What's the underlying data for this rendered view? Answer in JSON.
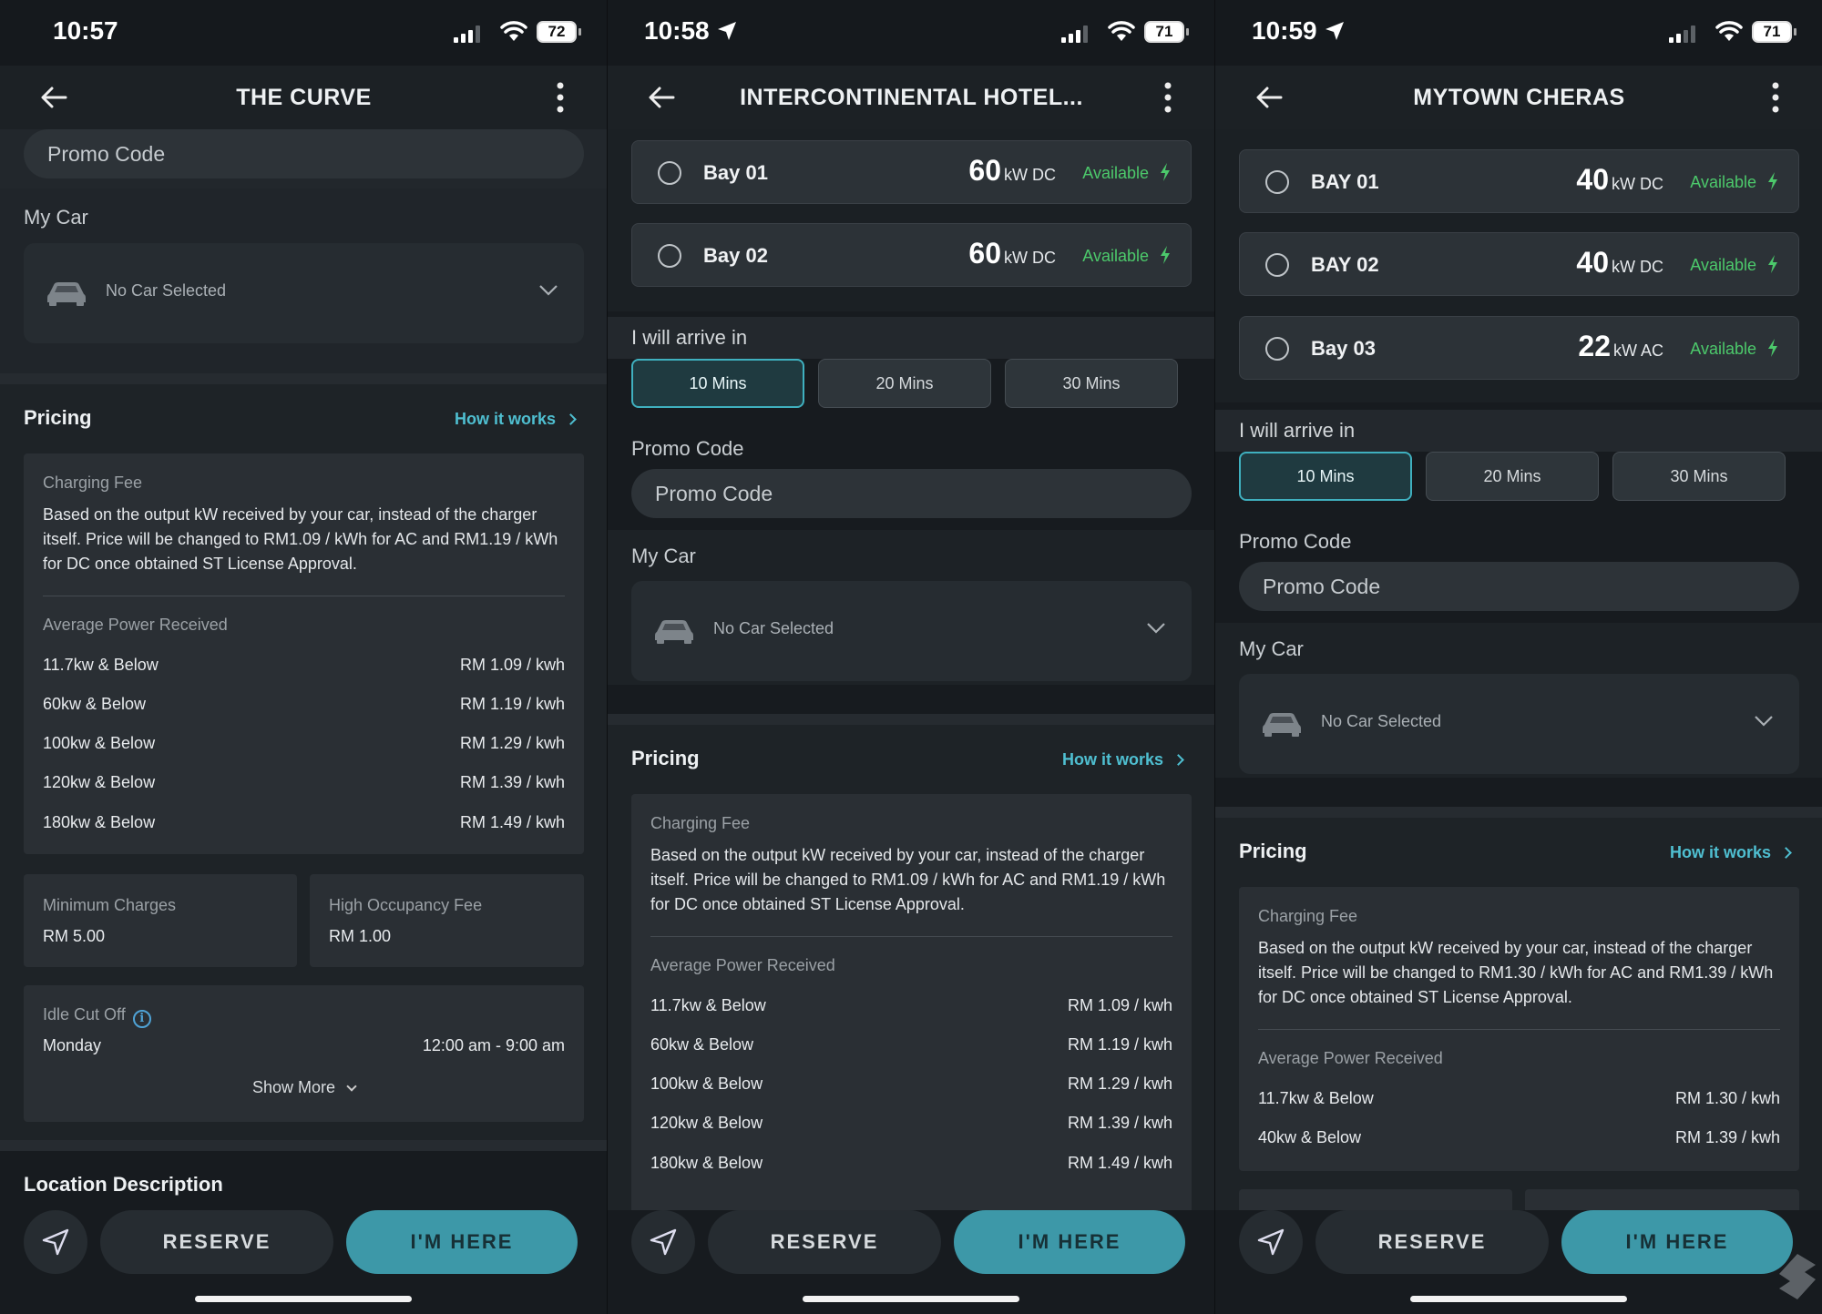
{
  "screens": [
    {
      "status": {
        "time": "10:57",
        "battery": "72",
        "location_arrow": false
      },
      "title": "THE CURVE",
      "promo_placeholder": "Promo Code",
      "my_car_label": "My Car",
      "car_value": "No Car Selected",
      "pricing": {
        "heading": "Pricing",
        "how_label": "How it works",
        "fee_title": "Charging Fee",
        "fee_desc": "Based on the output kW received by your car, instead of the charger itself. Price will be changed to RM1.09 / kWh for AC and RM1.19 / kWh for DC once obtained ST License Approval.",
        "avg_title": "Average Power Received",
        "rows": [
          {
            "tier": "11.7kw & Below",
            "price": "RM 1.09 / kwh"
          },
          {
            "tier": "60kw & Below",
            "price": "RM 1.19 / kwh"
          },
          {
            "tier": "100kw & Below",
            "price": "RM 1.29 / kwh"
          },
          {
            "tier": "120kw & Below",
            "price": "RM 1.39 / kwh"
          },
          {
            "tier": "180kw & Below",
            "price": "RM 1.49 / kwh"
          }
        ]
      },
      "min_charges_label": "Minimum Charges",
      "min_charges_value": "RM 5.00",
      "high_occ_label": "High Occupancy Fee",
      "high_occ_value": "RM 1.00",
      "idle_label": "Idle Cut Off",
      "idle_day": "Monday",
      "idle_time": "12:00 am - 9:00 am",
      "show_more": "Show More",
      "location_desc": "Location Description",
      "reserve": "RESERVE",
      "im_here": "I'M HERE"
    },
    {
      "status": {
        "time": "10:58",
        "battery": "71",
        "location_arrow": true
      },
      "title": "INTERCONTINENTAL HOTEL...",
      "bays": [
        {
          "name": "Bay 01",
          "kw": "60",
          "type": "kW DC",
          "status": "Available"
        },
        {
          "name": "Bay 02",
          "kw": "60",
          "type": "kW DC",
          "status": "Available"
        }
      ],
      "arrive_label": "I will arrive in",
      "mins": [
        "10 Mins",
        "20 Mins",
        "30 Mins"
      ],
      "selected_min": "10 Mins",
      "promo_label": "Promo Code",
      "promo_placeholder": "Promo Code",
      "my_car_label": "My Car",
      "car_value": "No Car Selected",
      "pricing": {
        "heading": "Pricing",
        "how_label": "How it works",
        "fee_title": "Charging Fee",
        "fee_desc": "Based on the output kW received by your car, instead of the charger itself. Price will be changed to RM1.09 / kWh for AC and RM1.19 / kWh for DC once obtained ST License Approval.",
        "avg_title": "Average Power Received",
        "rows": [
          {
            "tier": "11.7kw & Below",
            "price": "RM 1.09 / kwh"
          },
          {
            "tier": "60kw & Below",
            "price": "RM 1.19 / kwh"
          },
          {
            "tier": "100kw & Below",
            "price": "RM 1.29 / kwh"
          },
          {
            "tier": "120kw & Below",
            "price": "RM 1.39 / kwh"
          },
          {
            "tier": "180kw & Below",
            "price": "RM 1.49 / kwh"
          }
        ]
      },
      "reserve": "RESERVE",
      "im_here": "I'M HERE"
    },
    {
      "status": {
        "time": "10:59",
        "battery": "71",
        "location_arrow": true
      },
      "title": "MYTOWN CHERAS",
      "bays": [
        {
          "name": "BAY 01",
          "kw": "40",
          "type": "kW DC",
          "status": "Available"
        },
        {
          "name": "BAY 02",
          "kw": "40",
          "type": "kW DC",
          "status": "Available"
        },
        {
          "name": "Bay 03",
          "kw": "22",
          "type": "kW AC",
          "status": "Available"
        }
      ],
      "arrive_label": "I will arrive in",
      "mins": [
        "10 Mins",
        "20 Mins",
        "30 Mins"
      ],
      "selected_min": "10 Mins",
      "promo_label": "Promo Code",
      "promo_placeholder": "Promo Code",
      "my_car_label": "My Car",
      "car_value": "No Car Selected",
      "pricing": {
        "heading": "Pricing",
        "how_label": "How it works",
        "fee_title": "Charging Fee",
        "fee_desc": "Based on the output kW received by your car, instead of the charger itself. Price will be changed to RM1.30 / kWh for AC and RM1.39 / kWh for DC once obtained ST License Approval.",
        "avg_title": "Average Power Received",
        "rows": [
          {
            "tier": "11.7kw & Below",
            "price": "RM 1.30 / kwh"
          },
          {
            "tier": "40kw & Below",
            "price": "RM 1.39 / kwh"
          }
        ]
      },
      "reserve": "RESERVE",
      "im_here": "I'M HERE"
    }
  ],
  "colors": {
    "accent": "#3d98a8",
    "link": "#4fbfd1",
    "available": "#4cc96b",
    "background": "#171b1f"
  }
}
